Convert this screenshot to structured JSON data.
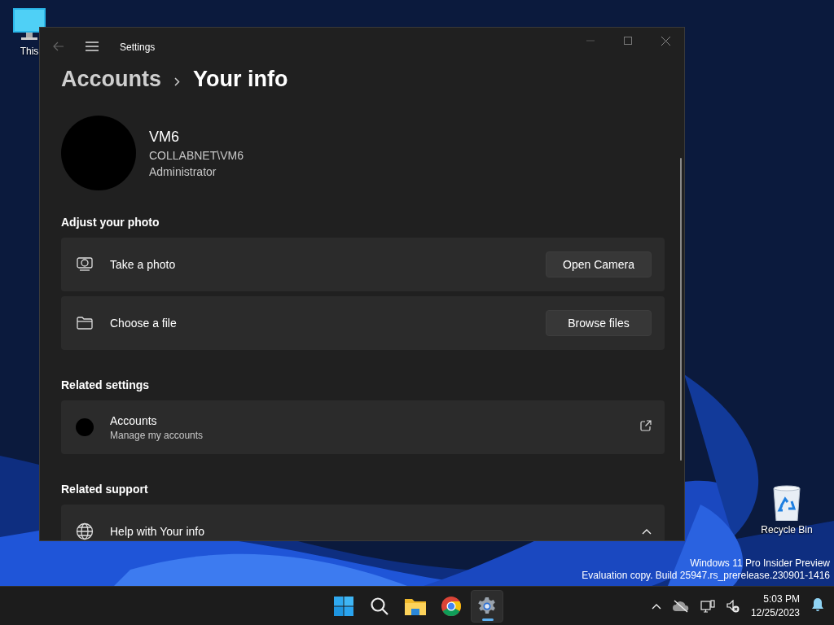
{
  "desktop": {
    "icons": [
      {
        "kind": "pc",
        "label": "This"
      },
      {
        "kind": "bin",
        "label": "Recycle Bin"
      }
    ],
    "watermark": [
      "Windows 11 Pro Insider Preview",
      "Evaluation copy. Build 25947.rs_prerelease.230901-1416"
    ]
  },
  "window": {
    "title": "Settings",
    "breadcrumb": [
      "Accounts",
      "Your info"
    ],
    "profile": {
      "name": "VM6",
      "account": "COLLABNET\\VM6",
      "role": "Administrator"
    },
    "sections": [
      {
        "heading": "Adjust your photo",
        "items": [
          {
            "kind": "action",
            "label": "Take a photo",
            "button": "Open Camera"
          },
          {
            "kind": "action",
            "label": "Choose a file",
            "button": "Browse files"
          }
        ]
      },
      {
        "heading": "Related settings",
        "items": [
          {
            "kind": "link",
            "label": "Accounts",
            "sublabel": "Manage my accounts"
          }
        ]
      },
      {
        "heading": "Related support",
        "items": [
          {
            "kind": "expander",
            "label": "Help with Your info",
            "expanded": true
          }
        ]
      }
    ]
  },
  "taskbar": {
    "apps": [
      {
        "kind": "start",
        "selected": false
      },
      {
        "kind": "search",
        "selected": false
      },
      {
        "kind": "explorer",
        "selected": false
      },
      {
        "kind": "browser",
        "selected": false
      },
      {
        "kind": "settings",
        "selected": true
      }
    ],
    "time": "5:03 PM",
    "date": "12/25/2023"
  }
}
